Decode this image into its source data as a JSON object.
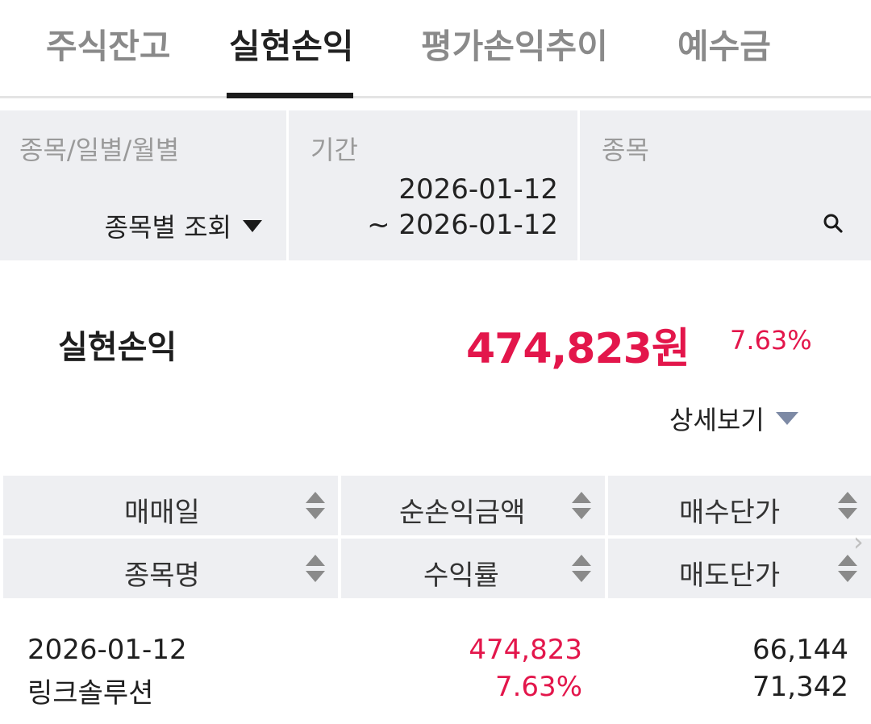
{
  "tabs": [
    {
      "label": "주식잔고",
      "active": false
    },
    {
      "label": "실현손익",
      "active": true
    },
    {
      "label": "평가손익추이",
      "active": false
    },
    {
      "label": "예수금",
      "active": false
    }
  ],
  "filter": {
    "group_label": "종목/일별/월별",
    "group_value": "종목별 조회",
    "period_label": "기간",
    "period_start": "2026-01-12",
    "period_end": "~ 2026-01-12",
    "stock_label": "종목",
    "search_icon": "search-icon"
  },
  "summary": {
    "label": "실현손익",
    "amount": "474,823원",
    "rate": "7.63%",
    "detail_label": "상세보기",
    "accent_color": "#e3164b"
  },
  "table": {
    "headers_row1": [
      "매매일",
      "순손익금액",
      "매수단가"
    ],
    "headers_row2": [
      "종목명",
      "수익률",
      "매도단가"
    ],
    "rows": [
      {
        "date": "2026-01-12",
        "name": "링크솔루션",
        "net_profit": "474,823",
        "rate": "7.63%",
        "buy_price": "66,144",
        "sell_price": "71,342"
      }
    ]
  }
}
